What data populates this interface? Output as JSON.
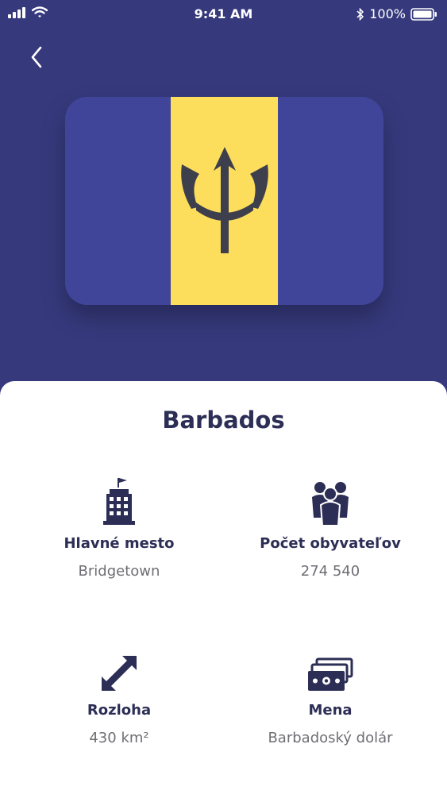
{
  "status_bar": {
    "time": "9:41 AM",
    "battery": "100%"
  },
  "nav": {
    "back_icon": "chevron-left-icon"
  },
  "flag": {
    "colors": {
      "blue": "#414599",
      "gold": "#fddd5c",
      "trident": "#3e3f4c"
    }
  },
  "country": {
    "name": "Barbados"
  },
  "info": {
    "capital": {
      "label": "Hlavné mesto",
      "value": "Bridgetown",
      "icon": "city-building-icon"
    },
    "population": {
      "label": "Počet obyvateľov",
      "value": "274 540",
      "icon": "people-group-icon"
    },
    "area": {
      "label": "Rozloha",
      "value": "430 km²",
      "icon": "resize-diagonal-arrow-icon"
    },
    "currency": {
      "label": "Mena",
      "value": "Barbadoský dolár",
      "icon": "money-bills-icon"
    }
  },
  "theme": {
    "background": "#363a7d",
    "card": "#ffffff",
    "text_dark": "#2c2e55",
    "text_muted": "#6e6e74"
  }
}
